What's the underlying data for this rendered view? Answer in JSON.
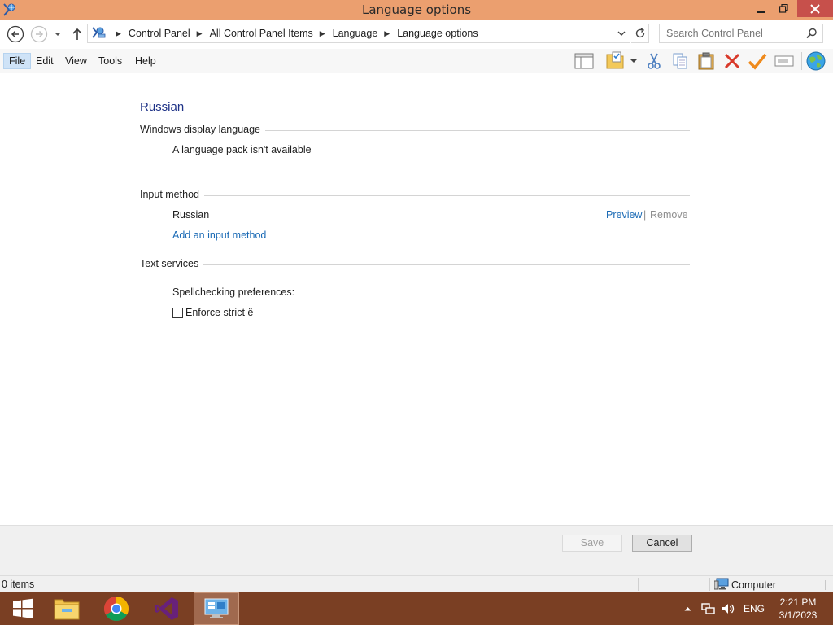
{
  "window": {
    "title": "Language options"
  },
  "address": {
    "breadcrumbs": [
      "Control Panel",
      "All Control Panel Items",
      "Language",
      "Language options"
    ]
  },
  "search": {
    "placeholder": "Search Control Panel"
  },
  "menu": {
    "items": [
      "File",
      "Edit",
      "View",
      "Tools",
      "Help"
    ],
    "active": "File"
  },
  "toolbar": {
    "icons": [
      "layout-pane-icon",
      "folder-checklist-icon",
      "cut-icon",
      "copy-icon",
      "paste-icon",
      "delete-icon",
      "checkmark-icon",
      "rename-icon",
      "globe-icon"
    ]
  },
  "main": {
    "language_title": "Russian",
    "display_section": {
      "label": "Windows display language",
      "message": "A language pack isn't available"
    },
    "input_section": {
      "label": "Input method",
      "method_name": "Russian",
      "preview_link": "Preview",
      "separator": "|",
      "remove_link": "Remove",
      "add_link": "Add an input method"
    },
    "text_services": {
      "label": "Text services",
      "spellcheck_label": "Spellchecking preferences:",
      "enforce_label": "Enforce strict ё",
      "enforce_checked": false
    }
  },
  "buttons": {
    "save": "Save",
    "cancel": "Cancel"
  },
  "status": {
    "items": "0 items",
    "zone": "Computer"
  },
  "taskbar": {
    "apps": [
      "start-icon",
      "file-explorer-icon",
      "chrome-icon",
      "visual-studio-icon",
      "control-panel-icon"
    ],
    "active_app": "control-panel-icon",
    "language": "ENG",
    "time": "2:21 PM",
    "date": "3/1/2023"
  },
  "colors": {
    "titlebar": "#eb9f6f",
    "close_button": "#c7504b",
    "taskbar": "#7a3f23",
    "link": "#1a6ab5",
    "heading": "#1e3287"
  }
}
